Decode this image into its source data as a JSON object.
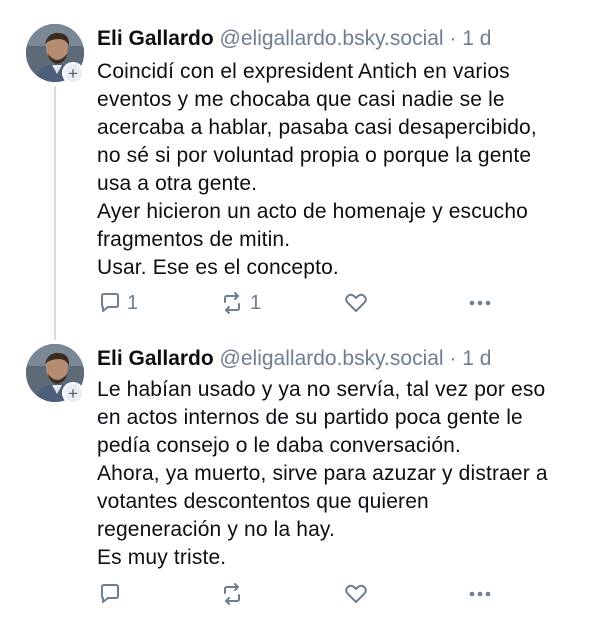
{
  "posts": [
    {
      "author_name": "Eli Gallardo",
      "handle": "@eligallardo.bsky.social",
      "separator": "·",
      "time": "1 d",
      "lines": [
        "Coincidí con el expresident Antich en varios",
        "eventos y me chocaba que casi nadie se le",
        "acercaba a hablar, pasaba casi desapercibido,",
        "no sé si por voluntad propia o porque la gente",
        "usa a otra gente.",
        "Ayer hicieron un acto de homenaje y escucho",
        "fragmentos de mitin.",
        "Usar. Ese es el concepto."
      ],
      "reply_count": "1",
      "repost_count": "1",
      "like_count": "",
      "more_icon": "ellipsis-icon"
    },
    {
      "author_name": "Eli Gallardo",
      "handle": "@eligallardo.bsky.social",
      "separator": "·",
      "time": "1 d",
      "lines": [
        "Le habían usado y ya no servía, tal vez por eso",
        "en actos internos de su partido poca gente le",
        "pedía consejo o le daba conversación.",
        "Ahora, ya muerto, sirve para azuzar y distraer a",
        "votantes descontentos que quieren",
        "regeneración y no la hay.",
        "Es muy triste."
      ],
      "reply_count": "",
      "repost_count": "",
      "like_count": "",
      "more_icon": "ellipsis-icon"
    }
  ],
  "avatar_plus": "+",
  "colors": {
    "text": "#0b0f14",
    "muted": "#6f7f8f",
    "thread_line": "#d6dde4"
  }
}
